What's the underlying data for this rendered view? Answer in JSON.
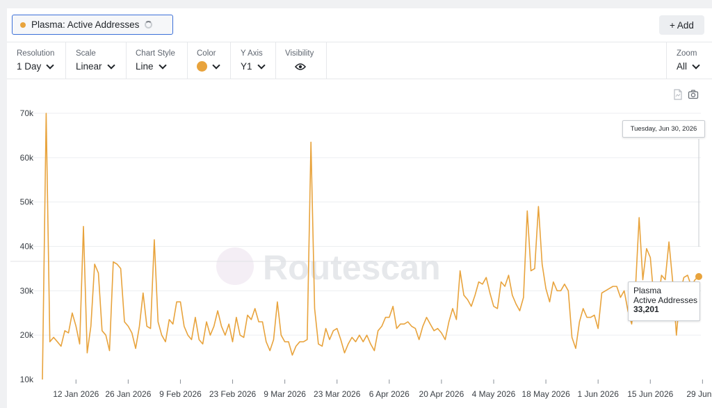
{
  "series_chip": {
    "label": "Plasma: Active Addresses",
    "dot_color": "#E8A33C"
  },
  "add_button": {
    "label": "+ Add"
  },
  "toolbar": {
    "resolution": {
      "title": "Resolution",
      "value": "1 Day"
    },
    "scale": {
      "title": "Scale",
      "value": "Linear"
    },
    "chart_style": {
      "title": "Chart Style",
      "value": "Line"
    },
    "color": {
      "title": "Color",
      "value": "#E8A33C"
    },
    "y_axis": {
      "title": "Y Axis",
      "value": "Y1"
    },
    "visibility": {
      "title": "Visibility",
      "icon": "eye-icon"
    },
    "zoom": {
      "title": "Zoom",
      "value": "All"
    }
  },
  "icons": {
    "csv": "csv-file-icon",
    "camera": "camera-icon"
  },
  "watermark": "Routescan",
  "tooltip": {
    "date": "Tuesday, Jun 30, 2026",
    "series_line1": "Plasma",
    "series_line2": "Active Addresses",
    "value": "33,201"
  },
  "chart_data": {
    "type": "line",
    "title": "",
    "xlabel": "",
    "ylabel": "",
    "ylim": [
      10000,
      70000
    ],
    "yticks": [
      10000,
      20000,
      30000,
      40000,
      50000,
      60000,
      70000
    ],
    "ytick_labels": [
      "10k",
      "20k",
      "30k",
      "40k",
      "50k",
      "60k",
      "70k"
    ],
    "xtick_labels": [
      "12 Jan 2026",
      "26 Jan 2026",
      "9 Feb 2026",
      "23 Feb 2026",
      "9 Mar 2026",
      "23 Mar 2026",
      "6 Apr 2026",
      "20 Apr 2026",
      "4 May 2026",
      "18 May 2026",
      "1 Jun 2026",
      "15 Jun 2026",
      "29 Jun..."
    ],
    "xtick_days": [
      9,
      23,
      37,
      51,
      65,
      79,
      93,
      107,
      121,
      135,
      149,
      163,
      177
    ],
    "x_start": "3 Jan 2026",
    "grid": true,
    "line_color": "#E8A33C",
    "series": [
      {
        "name": "Plasma: Active Addresses",
        "values": [
          10000,
          70000,
          18500,
          19500,
          18500,
          17500,
          21000,
          20500,
          25000,
          22000,
          18000,
          44500,
          16000,
          22000,
          36000,
          34000,
          21000,
          20000,
          16500,
          36500,
          36000,
          35000,
          23000,
          22000,
          20500,
          17000,
          22000,
          29500,
          22000,
          21500,
          41500,
          23000,
          20000,
          18500,
          23500,
          22500,
          27500,
          27500,
          22000,
          20000,
          19000,
          24000,
          19000,
          18000,
          23000,
          20000,
          22000,
          25500,
          22000,
          20000,
          22500,
          18500,
          24000,
          20000,
          19500,
          24500,
          23500,
          26000,
          23000,
          23000,
          18500,
          16500,
          19000,
          27500,
          20000,
          18500,
          18500,
          15500,
          17500,
          18500,
          18500,
          19000,
          63500,
          26000,
          18000,
          17500,
          21500,
          19000,
          21000,
          21500,
          19000,
          16000,
          18000,
          19500,
          18500,
          20000,
          18500,
          20000,
          18000,
          16500,
          21000,
          22000,
          24000,
          24000,
          26500,
          21500,
          22500,
          22500,
          23000,
          22000,
          21500,
          19000,
          22000,
          24000,
          22500,
          21000,
          21500,
          20500,
          19000,
          23000,
          26000,
          23500,
          34500,
          29000,
          28000,
          26500,
          29000,
          32000,
          31500,
          33000,
          29500,
          26500,
          26000,
          32000,
          31000,
          33500,
          29000,
          27000,
          25500,
          28500,
          48000,
          34500,
          35000,
          49000,
          36000,
          30500,
          27500,
          32000,
          30000,
          30000,
          31500,
          30000,
          19500,
          17000,
          23000,
          26000,
          24000,
          24000,
          24500,
          21500,
          29500,
          30000,
          30500,
          31000,
          31000,
          28500,
          30000,
          25500,
          22500,
          30000,
          46500,
          32500,
          39500,
          37500,
          28000,
          27000,
          33500,
          32500,
          41000,
          32000,
          20000,
          29500,
          33000,
          33500,
          31000,
          32500,
          33201
        ]
      }
    ]
  }
}
